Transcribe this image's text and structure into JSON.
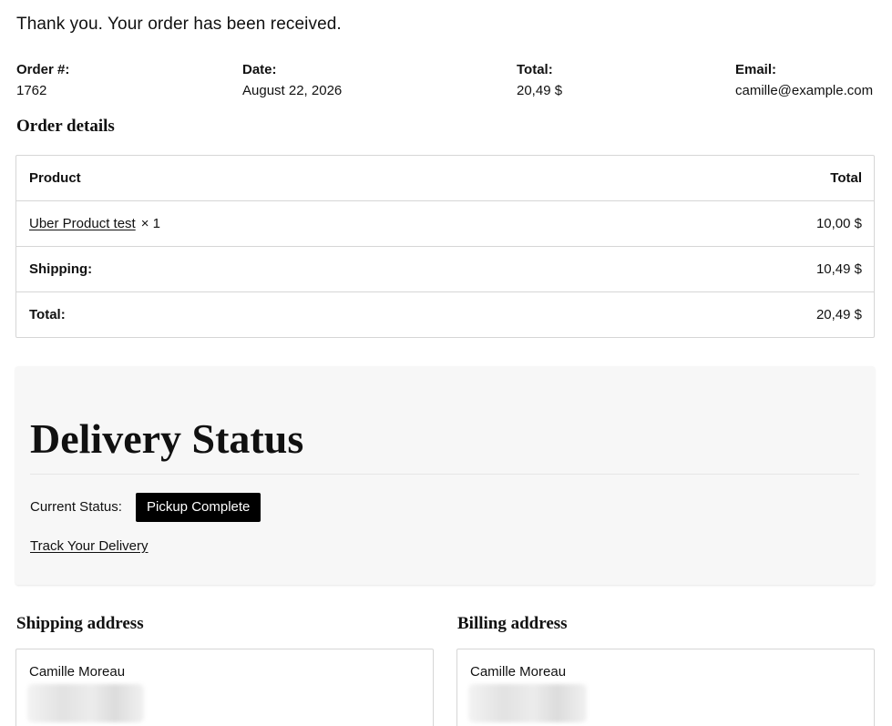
{
  "header": {
    "thank_you": "Thank you. Your order has been received."
  },
  "overview": {
    "order_label": "Order #:",
    "order_value": "1762",
    "date_label": "Date:",
    "date_value": "August 22, 2026",
    "total_label": "Total:",
    "total_value": "20,49 $",
    "email_label": "Email:",
    "email_value": "camille@example.com"
  },
  "order_details": {
    "heading": "Order details",
    "columns": {
      "product": "Product",
      "total": "Total"
    },
    "items": [
      {
        "name": "Uber Product test",
        "quantity": "× 1",
        "total": "10,00 $"
      }
    ],
    "shipping_label": "Shipping:",
    "shipping_value": "10,49 $",
    "total_label": "Total:",
    "total_value": "20,49 $"
  },
  "delivery": {
    "title": "Delivery Status",
    "current_status_label": "Current Status:",
    "current_status_value": "Pickup Complete",
    "track_link": "Track Your Delivery",
    "badge_color": "#000000"
  },
  "addresses": {
    "shipping_heading": "Shipping address",
    "billing_heading": "Billing address",
    "shipping_name": "Camille Moreau",
    "billing_name": "Camille Moreau"
  }
}
